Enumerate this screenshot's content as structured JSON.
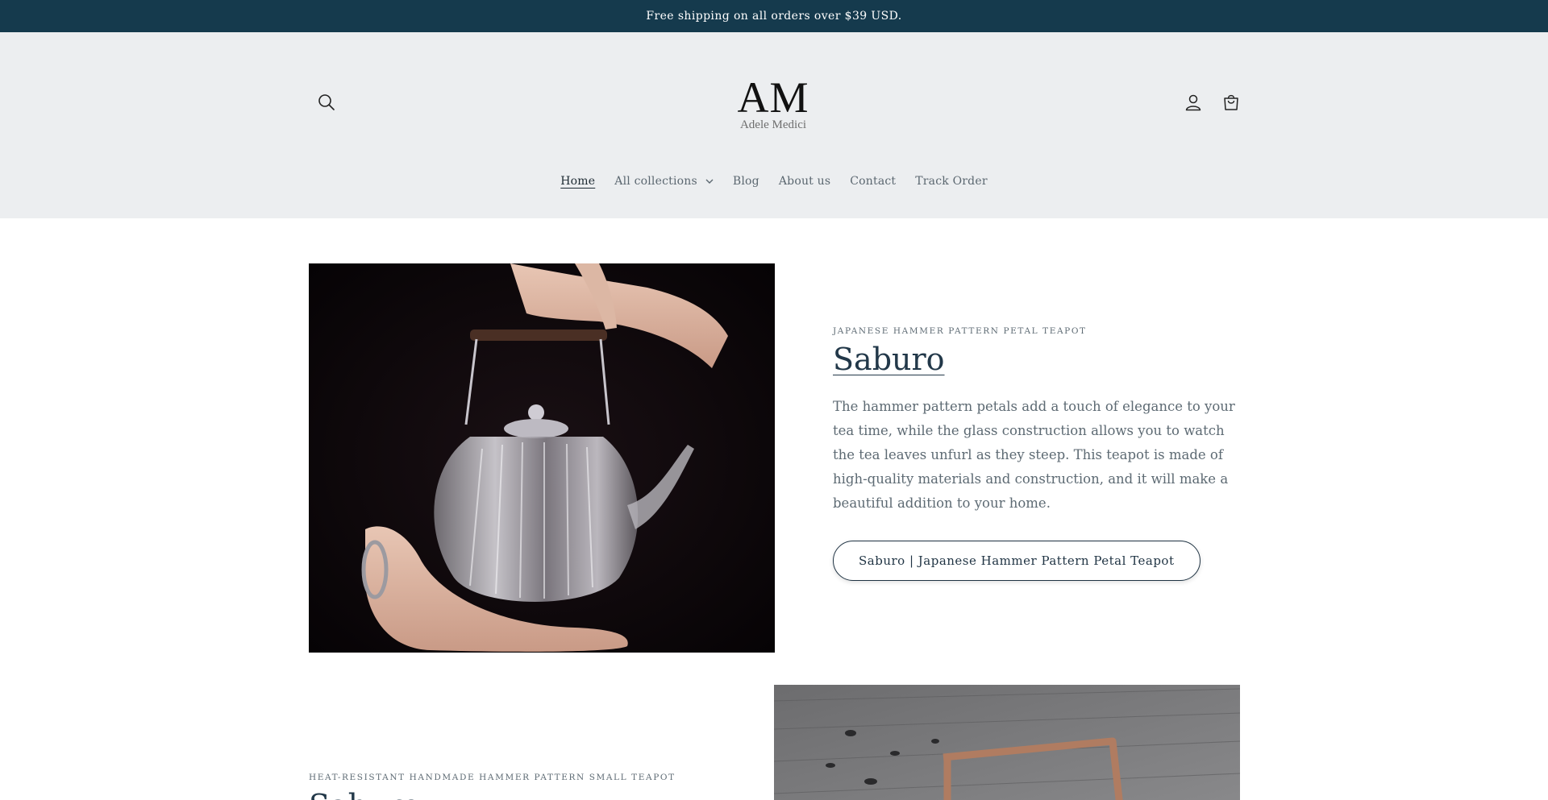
{
  "announcement": {
    "text": "Free shipping on all orders over $39 USD."
  },
  "header": {
    "logo_mark": "AM",
    "logo_sub": "Adele Medici",
    "icons": {
      "search": "search-icon",
      "account": "account-icon",
      "cart": "cart-icon"
    }
  },
  "nav": {
    "items": [
      {
        "label": "Home",
        "active": true
      },
      {
        "label": "All collections",
        "has_dropdown": true
      },
      {
        "label": "Blog"
      },
      {
        "label": "About us"
      },
      {
        "label": "Contact"
      },
      {
        "label": "Track Order"
      }
    ]
  },
  "features": [
    {
      "kicker": "JAPANESE HAMMER PATTERN PETAL TEAPOT",
      "title": "Saburo",
      "description": "The hammer pattern petals add a touch of elegance to your tea time, while the glass construction allows you to watch the tea leaves unfurl as they steep. This teapot is made of high-quality materials and construction, and it will make a beautiful addition to your home.",
      "button": "Saburo | Japanese Hammer Pattern Petal Teapot",
      "image": "glass-teapot-photo"
    },
    {
      "kicker": "HEAT-RESISTANT HANDMADE HAMMER PATTERN SMALL TEAPOT",
      "title": "Saburo",
      "image": "copper-handle-teapot-photo"
    }
  ],
  "colors": {
    "announcement_bg": "#153a4d",
    "header_bg": "#eceef0",
    "accent": "#1f3343"
  }
}
